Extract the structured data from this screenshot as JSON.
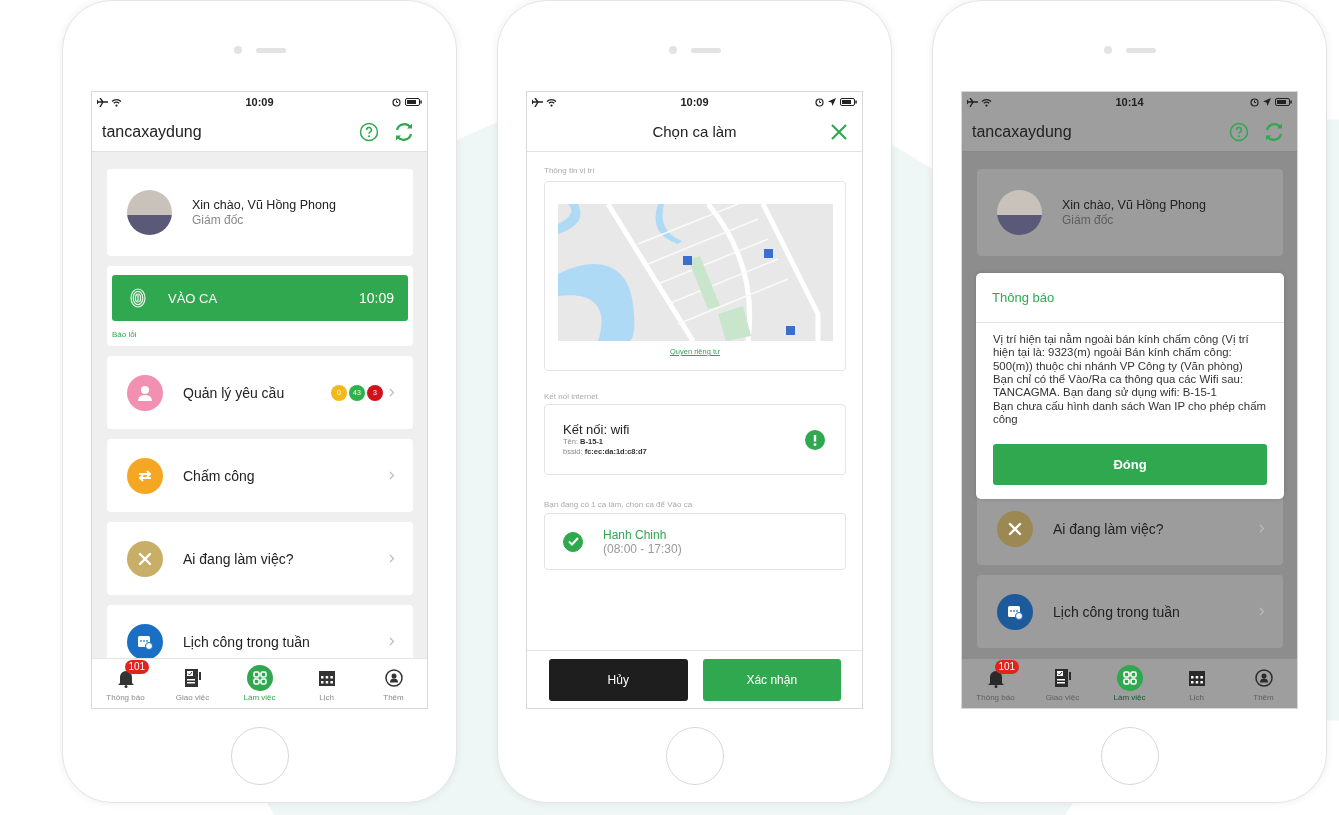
{
  "phones": [
    {
      "kind": "home",
      "status_bar": {
        "time": "10:09",
        "location_on": false
      },
      "header": {
        "title": "tancaxaydung"
      },
      "greeting": {
        "text": "Xin chào, Vũ Hồng Phong",
        "role": "Giám đốc"
      },
      "check_in": {
        "label": "VÀO CA",
        "time": "10:09",
        "report_link": "Báo lỗi"
      },
      "menu": [
        {
          "kind": "requests",
          "label": "Quản lý yêu cầu",
          "color": "#f290b2",
          "badges": [
            {
              "count": "0",
              "color": "#f5b81c"
            },
            {
              "count": "43",
              "color": "#2db34a"
            },
            {
              "count": "3",
              "color": "#d0121b"
            }
          ]
        },
        {
          "kind": "timekeeping",
          "label": "Chấm công",
          "color": "#f5a623"
        },
        {
          "kind": "who_working",
          "label": "Ai đang làm việc?",
          "color": "#c9ae68"
        },
        {
          "kind": "weekly_schedule",
          "label": "Lịch công trong tuần",
          "color": "#1a6fc4"
        }
      ],
      "tab_bar": [
        {
          "label": "Thông báo",
          "badge": "101",
          "selected": false
        },
        {
          "label": "Giao việc",
          "selected": false
        },
        {
          "label": "Làm việc",
          "selected": true
        },
        {
          "label": "Lịch",
          "selected": false
        },
        {
          "label": "Thêm",
          "selected": false
        }
      ]
    },
    {
      "kind": "shift_picker",
      "status_bar": {
        "time": "10:09",
        "location_on": true
      },
      "header": {
        "title": "Chọn ca làm"
      },
      "location": {
        "label": "Thông tin vị trí",
        "privacy_link": "Quyền riêng tư"
      },
      "internet": {
        "label": "Kết nối internet",
        "title": "Kết nối: wifi",
        "name": "Tên: **B-15-1**",
        "bssid": "bssid: **fc:ec:da:1d:c8:d7**"
      },
      "shift_label": "Bạn đang có 1 ca làm, chọn ca để Vào ca",
      "shifts": [
        {
          "name": "Hanh Chinh",
          "hours": "(08:00 - 17:30)",
          "selected": true
        }
      ],
      "buttons": [
        {
          "kind": "cancel",
          "label": "Hủy"
        },
        {
          "kind": "confirm",
          "label": "Xác nhận"
        }
      ]
    },
    {
      "kind": "home_dialog",
      "status_bar": {
        "time": "10:14",
        "location_on": true
      },
      "header": {
        "title": "tancaxaydung"
      },
      "greeting": {
        "text": "Xin chào, Vũ Hồng Phong",
        "role": "Giám đốc"
      },
      "dialog": {
        "title": "Thông báo",
        "message": [
          "Vị trí hiện tại nằm ngoài bán kính chấm công (Vị trí hiện tại là: 9323(m) ngoài Bán kính chấm công: 500(m)) thuộc chi nhánh VP Công ty (Văn phòng)",
          "Bạn chỉ có thể Vào/Ra ca thông qua các Wifi sau: TANCAGMA. Bạn đang sử dụng wifi: B-15-1",
          "Bạn chưa cấu hình danh sách Wan IP cho phép chấm công"
        ],
        "button": "Đóng"
      },
      "menu": [
        {
          "kind": "who_working",
          "label": "Ai đang làm việc?",
          "color": "#9c8853"
        },
        {
          "kind": "weekly_schedule",
          "label": "Lịch công trong tuần",
          "color": "#1c5a9c"
        }
      ],
      "tab_bar": [
        {
          "label": "Thông báo",
          "badge": "101",
          "selected": false
        },
        {
          "label": "Giao việc",
          "selected": false
        },
        {
          "label": "Làm việc",
          "selected": true
        },
        {
          "label": "Lịch",
          "selected": false
        },
        {
          "label": "Thêm",
          "selected": false
        }
      ]
    }
  ]
}
